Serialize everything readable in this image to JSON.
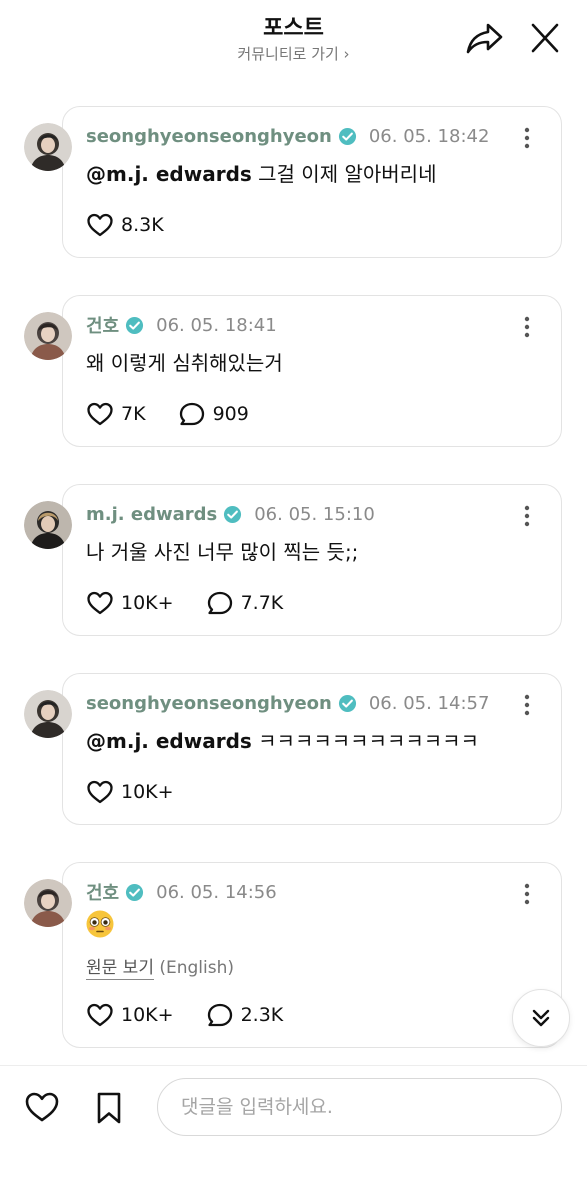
{
  "header": {
    "title": "포스트",
    "community_link": "커뮤니티로 가기 ›"
  },
  "comments": [
    {
      "username": "seonghyeonseonghyeon",
      "timestamp": "06. 05. 18:42",
      "mention": "@m.j. edwards",
      "text": " 그걸 이제 알아버리네",
      "likes": "8.3K",
      "avatar_color": "#3a3530"
    },
    {
      "username": "건호",
      "timestamp": "06. 05. 18:41",
      "text": "왜 이렇게 심취해있는거",
      "likes": "7K",
      "replies": "909",
      "avatar_color": "#4b4340"
    },
    {
      "username": "m.j. edwards",
      "timestamp": "06. 05. 15:10",
      "text": "나 거울 사진 너무 많이 찍는 듯;;",
      "likes": "10K+",
      "replies": "7.7K",
      "avatar_color": "#2c2a28"
    },
    {
      "username": "seonghyeonseonghyeon",
      "timestamp": "06. 05. 14:57",
      "mention": "@m.j. edwards",
      "text": " ㅋㅋㅋㅋㅋㅋㅋㅋㅋㅋㅋㅋ",
      "likes": "10K+",
      "avatar_color": "#3a3530"
    },
    {
      "username": "건호",
      "timestamp": "06. 05. 14:56",
      "emoji": "flushed-face",
      "translate_link": "원문 보기",
      "translate_lang": " (English)",
      "likes": "10K+",
      "replies": "2.3K",
      "avatar_color": "#4b4340"
    }
  ],
  "bottom_bar": {
    "comment_placeholder": "댓글을 입력하세요."
  },
  "colors": {
    "username": "#6f8f80",
    "verified_badge": "#4fbdc0",
    "timestamp": "#8a8a8a",
    "card_border": "#e3e3e3"
  },
  "icons": [
    "share-icon",
    "close-icon",
    "verified-badge-icon",
    "more-icon",
    "heart-icon",
    "reply-icon",
    "chevrons-down-icon",
    "bookmark-icon"
  ]
}
